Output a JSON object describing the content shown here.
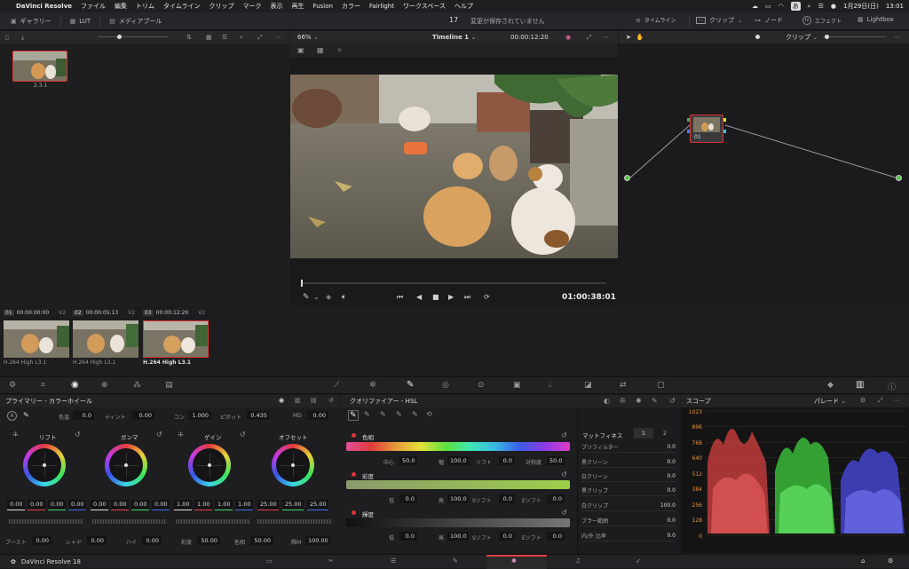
{
  "menubar": {
    "app": "DaVinci Resolve",
    "items": [
      "ファイル",
      "編集",
      "トリム",
      "タイムライン",
      "クリップ",
      "マーク",
      "表示",
      "再生",
      "Fusion",
      "カラー",
      "Fairlight",
      "ワークスペース",
      "ヘルプ"
    ],
    "input_mode": "あ",
    "date": "1月29日(日)",
    "time": "13:01"
  },
  "toolbar": {
    "gallery": "ギャラリー",
    "lut": "LUT",
    "media_pool": "メディアプール",
    "count": "17",
    "status": "変更が保存されていません",
    "timeline": "タイムライン",
    "clip": "クリップ",
    "node": "ノード",
    "effects": "エフェクト",
    "lightbox": "Lightbox"
  },
  "viewer": {
    "zoom": "66%",
    "timeline_name": "Timeline 1",
    "timecode": "00:00:12:20",
    "duration": "01:00:38:01"
  },
  "gallery": {
    "still_label": "2.3.1"
  },
  "nodes": {
    "mode": "クリップ",
    "node_label": "01"
  },
  "clips": [
    {
      "num": "01",
      "tc": "00:00:00:00",
      "track": "V2",
      "codec": "H.264 High L3.1"
    },
    {
      "num": "02",
      "tc": "00:00:05:13",
      "track": "V2",
      "codec": "H.264 High L3.1"
    },
    {
      "num": "03",
      "tc": "00:00:12:20",
      "track": "V2",
      "codec": "H.264 High L3.1"
    }
  ],
  "primaries": {
    "title": "プライマリー - カラーホイール",
    "temp_label": "色温",
    "temp": "0.0",
    "tint_label": "ティント",
    "tint": "0.00",
    "contrast_label": "コン",
    "contrast": "1.000",
    "pivot_label": "ピボット",
    "pivot": "0.435",
    "md_label": "MD",
    "md": "0.00",
    "wheels": [
      {
        "name": "リフト",
        "vals": [
          "0.00",
          "0.00",
          "0.00",
          "0.00"
        ]
      },
      {
        "name": "ガンマ",
        "vals": [
          "0.00",
          "0.00",
          "0.00",
          "0.00"
        ]
      },
      {
        "name": "ゲイン",
        "vals": [
          "1.00",
          "1.00",
          "1.00",
          "1.00"
        ]
      },
      {
        "name": "オフセット",
        "vals": [
          "25.00",
          "25.00",
          "25.00"
        ]
      }
    ],
    "boost_label": "ブースト",
    "boost": "0.00",
    "shadow_label": "シャド",
    "shadow": "0.00",
    "hi_label": "ハイ",
    "hi": "0.00",
    "sat_label": "彩度",
    "sat": "50.00",
    "hue_label": "色相",
    "hue": "50.00",
    "lummix_label": "輝M",
    "lummix": "100.00"
  },
  "qualifier": {
    "title": "クオリファイアー - HSL",
    "hue": {
      "label": "色相",
      "center_label": "中心",
      "center": "50.0",
      "width_label": "幅",
      "width": "100.0",
      "soft_label": "ソフト",
      "soft": "0.0",
      "sym_label": "対称度",
      "sym": "50.0"
    },
    "sat": {
      "label": "彩度",
      "low_label": "低",
      "low": "0.0",
      "high_label": "高",
      "high": "100.0",
      "lsoft_label": "Sソフト",
      "lsoft": "0.0",
      "hsoft_label": "Eソフト",
      "hsoft": "0.0"
    },
    "lum": {
      "label": "輝度",
      "low_label": "低",
      "low": "0.0",
      "high_label": "高",
      "high": "100.0",
      "lsoft_label": "Sソフト",
      "lsoft": "0.0",
      "hsoft_label": "Eソフト",
      "hsoft": "0.0"
    }
  },
  "matte": {
    "title": "マットフィネス",
    "tab1": "1",
    "tab2": "2",
    "rows": [
      {
        "label": "プリフィルター",
        "value": "0.0"
      },
      {
        "label": "黒クリーン",
        "value": "0.0"
      },
      {
        "label": "白クリーン",
        "value": "0.0"
      },
      {
        "label": "黒クリップ",
        "value": "0.0"
      },
      {
        "label": "白クリップ",
        "value": "100.0"
      },
      {
        "label": "ブラー範囲",
        "value": "0.0"
      },
      {
        "label": "内/外 比率",
        "value": "0.0"
      }
    ]
  },
  "scope": {
    "title": "スコープ",
    "mode": "パレード",
    "ticks": [
      "1023",
      "896",
      "768",
      "640",
      "512",
      "384",
      "256",
      "128",
      "0"
    ]
  },
  "app_version": "DaVinci Resolve 18"
}
